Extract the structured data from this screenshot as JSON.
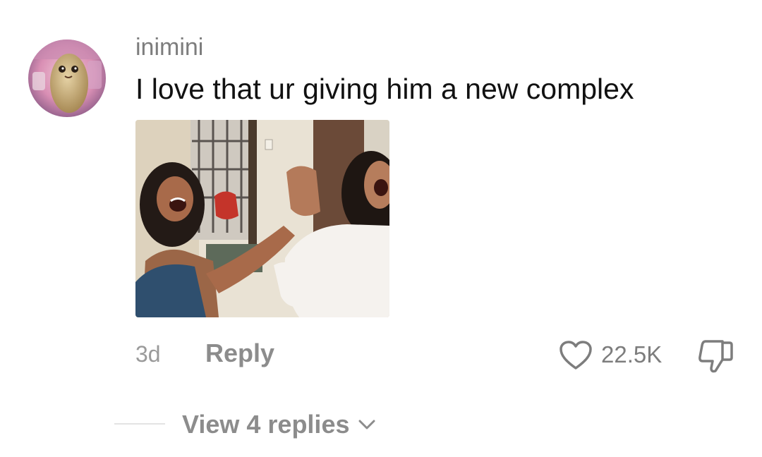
{
  "comment": {
    "username": "inimini",
    "text": "I love that ur giving him a new complex",
    "timestamp": "3d",
    "reply_label": "Reply",
    "like_count": "22.5K",
    "view_replies_label": "View 4 replies"
  },
  "icons": {
    "like": "heart-icon",
    "dislike": "thumbs-down-icon",
    "expand": "chevron-down-icon"
  },
  "colors": {
    "username": "#7d7d7d",
    "text": "#111111",
    "muted": "#8c8c8c",
    "divider": "#e3e3e3"
  }
}
